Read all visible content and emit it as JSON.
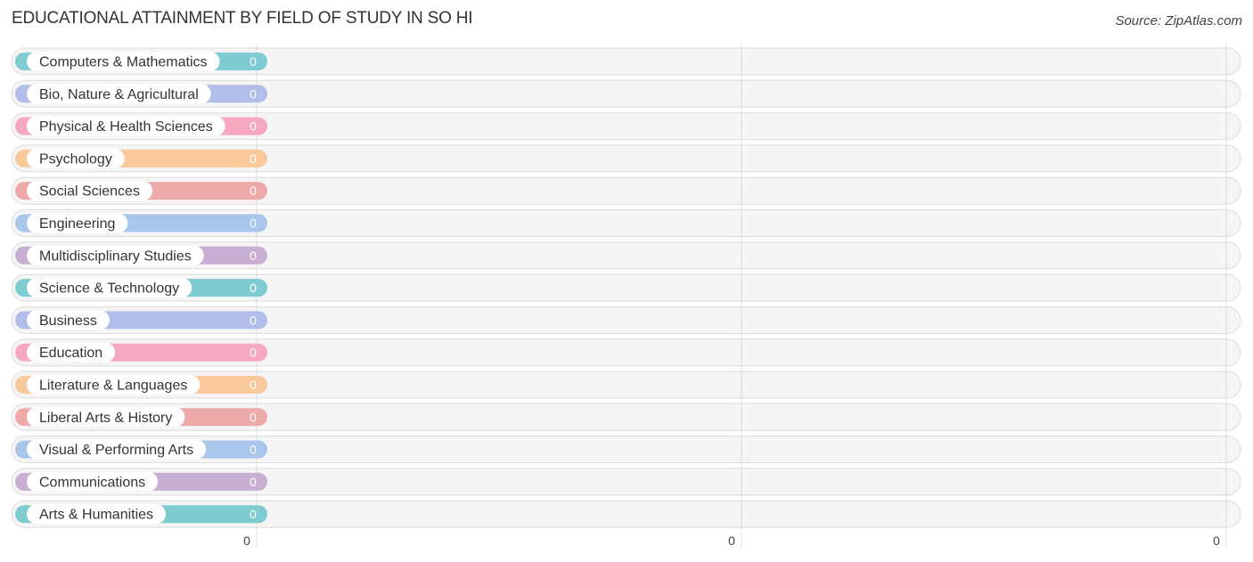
{
  "header": {
    "title": "EDUCATIONAL ATTAINMENT BY FIELD OF STUDY IN SO HI",
    "source": "Source: ZipAtlas.com"
  },
  "chart_data": {
    "type": "bar",
    "orientation": "horizontal",
    "title": "EDUCATIONAL ATTAINMENT BY FIELD OF STUDY IN SO HI",
    "xlabel": "",
    "ylabel": "",
    "categories": [
      "Computers & Mathematics",
      "Bio, Nature & Agricultural",
      "Physical & Health Sciences",
      "Psychology",
      "Social Sciences",
      "Engineering",
      "Multidisciplinary Studies",
      "Science & Technology",
      "Business",
      "Education",
      "Literature & Languages",
      "Liberal Arts & History",
      "Visual & Performing Arts",
      "Communications",
      "Arts & Humanities"
    ],
    "values": [
      0,
      0,
      0,
      0,
      0,
      0,
      0,
      0,
      0,
      0,
      0,
      0,
      0,
      0,
      0
    ],
    "value_labels": [
      "0",
      "0",
      "0",
      "0",
      "0",
      "0",
      "0",
      "0",
      "0",
      "0",
      "0",
      "0",
      "0",
      "0",
      "0"
    ],
    "colors": [
      "#7ecbd1",
      "#b3bde9",
      "#f6a8c0",
      "#f9c99c",
      "#eeaaa8",
      "#a8c5ea",
      "#c9aed4",
      "#7ecbd1",
      "#b3bde9",
      "#f6a8c0",
      "#f9c99c",
      "#eeaaa8",
      "#a8c5ea",
      "#c9aed4",
      "#7ecbd1"
    ],
    "x_ticks": [
      "0",
      "0",
      "0"
    ],
    "xlim": [
      0,
      0
    ],
    "grid": true,
    "legend": "none"
  }
}
